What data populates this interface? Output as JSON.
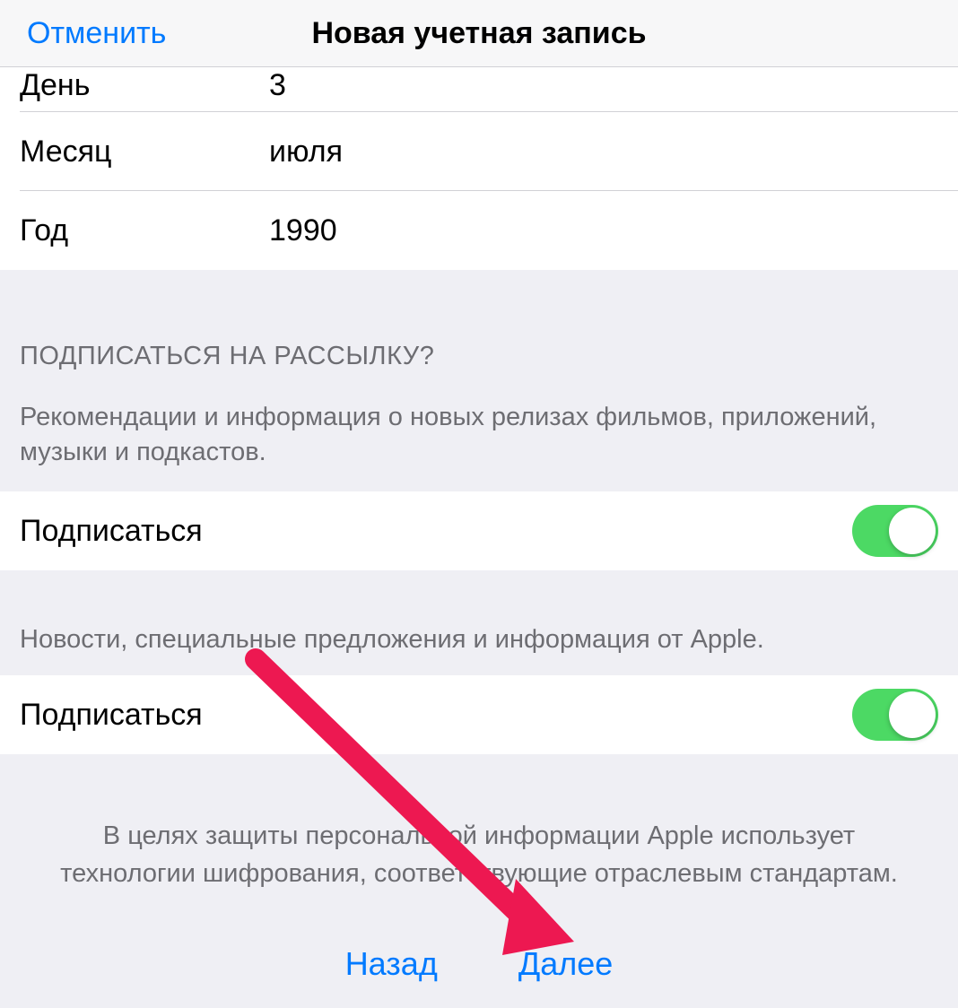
{
  "nav": {
    "cancel": "Отменить",
    "title": "Новая учетная запись"
  },
  "date_rows": {
    "day_label": "День",
    "day_value": "3",
    "month_label": "Месяц",
    "month_value": "июля",
    "year_label": "Год",
    "year_value": "1990"
  },
  "subscribe_section": {
    "header": "ПОДПИСАТЬСЯ НА РАССЫЛКУ?",
    "desc1": "Рекомендации и информация о новых релизах фильмов, приложений, музыки и подкастов.",
    "toggle1_label": "Подписаться",
    "toggle1_on": true,
    "desc2": "Новости, специальные предложения и информация от Apple.",
    "toggle2_label": "Подписаться",
    "toggle2_on": true
  },
  "privacy": "В целях защиты персональной информации Apple использует технологии шифрования, соответствующие отраслевым стандартам.",
  "buttons": {
    "back": "Назад",
    "next": "Далее"
  }
}
